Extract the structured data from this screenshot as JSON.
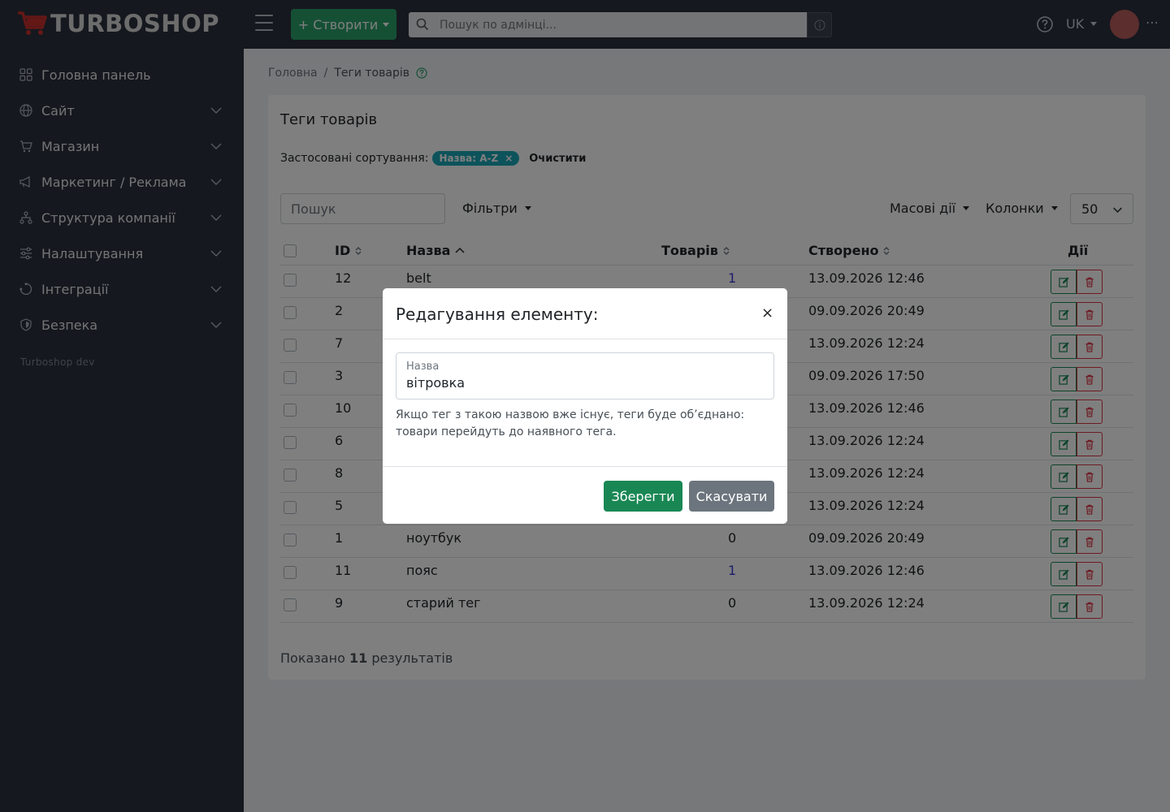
{
  "app": {
    "logo_text": "TURBOSHOP",
    "create_label": "+ Створити",
    "search_placeholder": "Пошук по адмінці...",
    "lang": "UK"
  },
  "sidebar": {
    "items": [
      {
        "label": "Головна панель",
        "icon": "grid-icon"
      },
      {
        "label": "Сайт",
        "icon": "globe-icon"
      },
      {
        "label": "Магазин",
        "icon": "cart-icon"
      },
      {
        "label": "Маркетинг / Реклама",
        "icon": "megaphone-icon"
      },
      {
        "label": "Структура компанії",
        "icon": "org-chart-icon"
      },
      {
        "label": "Налаштування",
        "icon": "sliders-icon"
      },
      {
        "label": "Інтеграції",
        "icon": "integration-icon"
      },
      {
        "label": "Безпека",
        "icon": "shield-icon"
      }
    ],
    "footer": "Turboshop dev"
  },
  "breadcrumb": {
    "home": "Головна",
    "separator": "/",
    "current": "Теги товарів"
  },
  "page": {
    "title": "Теги товарів",
    "sort_label": "Застосовані сортування:",
    "sort_badge": "Назва: A-Z",
    "sort_badge_close": "×",
    "clear": "Очистити",
    "search_placeholder": "Пошук",
    "filters": "Фільтри",
    "mass_actions": "Масові дії",
    "columns": "Колонки",
    "per_page": "50",
    "results_prefix": "Показано",
    "results_count": "11",
    "results_suffix": "результатів"
  },
  "table": {
    "headers": {
      "id": "ID",
      "name": "Назва",
      "count": "Товарів",
      "created": "Створено",
      "actions": "Дії"
    },
    "rows": [
      {
        "id": "12",
        "name": "belt",
        "count": "1",
        "created": "13.09.2026 12:46"
      },
      {
        "id": "2",
        "name": "",
        "count": "",
        "created": "09.09.2026 20:49"
      },
      {
        "id": "7",
        "name": "",
        "count": "",
        "created": "13.09.2026 12:24"
      },
      {
        "id": "3",
        "name": "",
        "count": "",
        "created": "09.09.2026 17:50"
      },
      {
        "id": "10",
        "name": "",
        "count": "",
        "created": "13.09.2026 12:46"
      },
      {
        "id": "6",
        "name": "",
        "count": "",
        "created": "13.09.2026 12:24"
      },
      {
        "id": "8",
        "name": "",
        "count": "",
        "created": "13.09.2026 12:24"
      },
      {
        "id": "5",
        "name": "",
        "count": "",
        "created": "13.09.2026 12:24"
      },
      {
        "id": "1",
        "name": "ноутбук",
        "count": "0",
        "created": "09.09.2026 20:49"
      },
      {
        "id": "11",
        "name": "пояс",
        "count": "1",
        "created": "13.09.2026 12:46"
      },
      {
        "id": "9",
        "name": "старий тег",
        "count": "0",
        "created": "13.09.2026 12:24"
      }
    ]
  },
  "modal": {
    "title": "Редагування елементу:",
    "close": "×",
    "field_label": "Назва",
    "field_value": "вітровка",
    "hint": "Якщо тег з такою назвою вже існує, теги буде об’єднано: товари перейдуть до наявного тега.",
    "save": "Зберегти",
    "cancel": "Скасувати"
  },
  "colors": {
    "topbar": "#2b313d",
    "accent_green": "#2aa06b",
    "badge": "#1aa6b7",
    "danger": "#dc3545",
    "success": "#198754"
  }
}
